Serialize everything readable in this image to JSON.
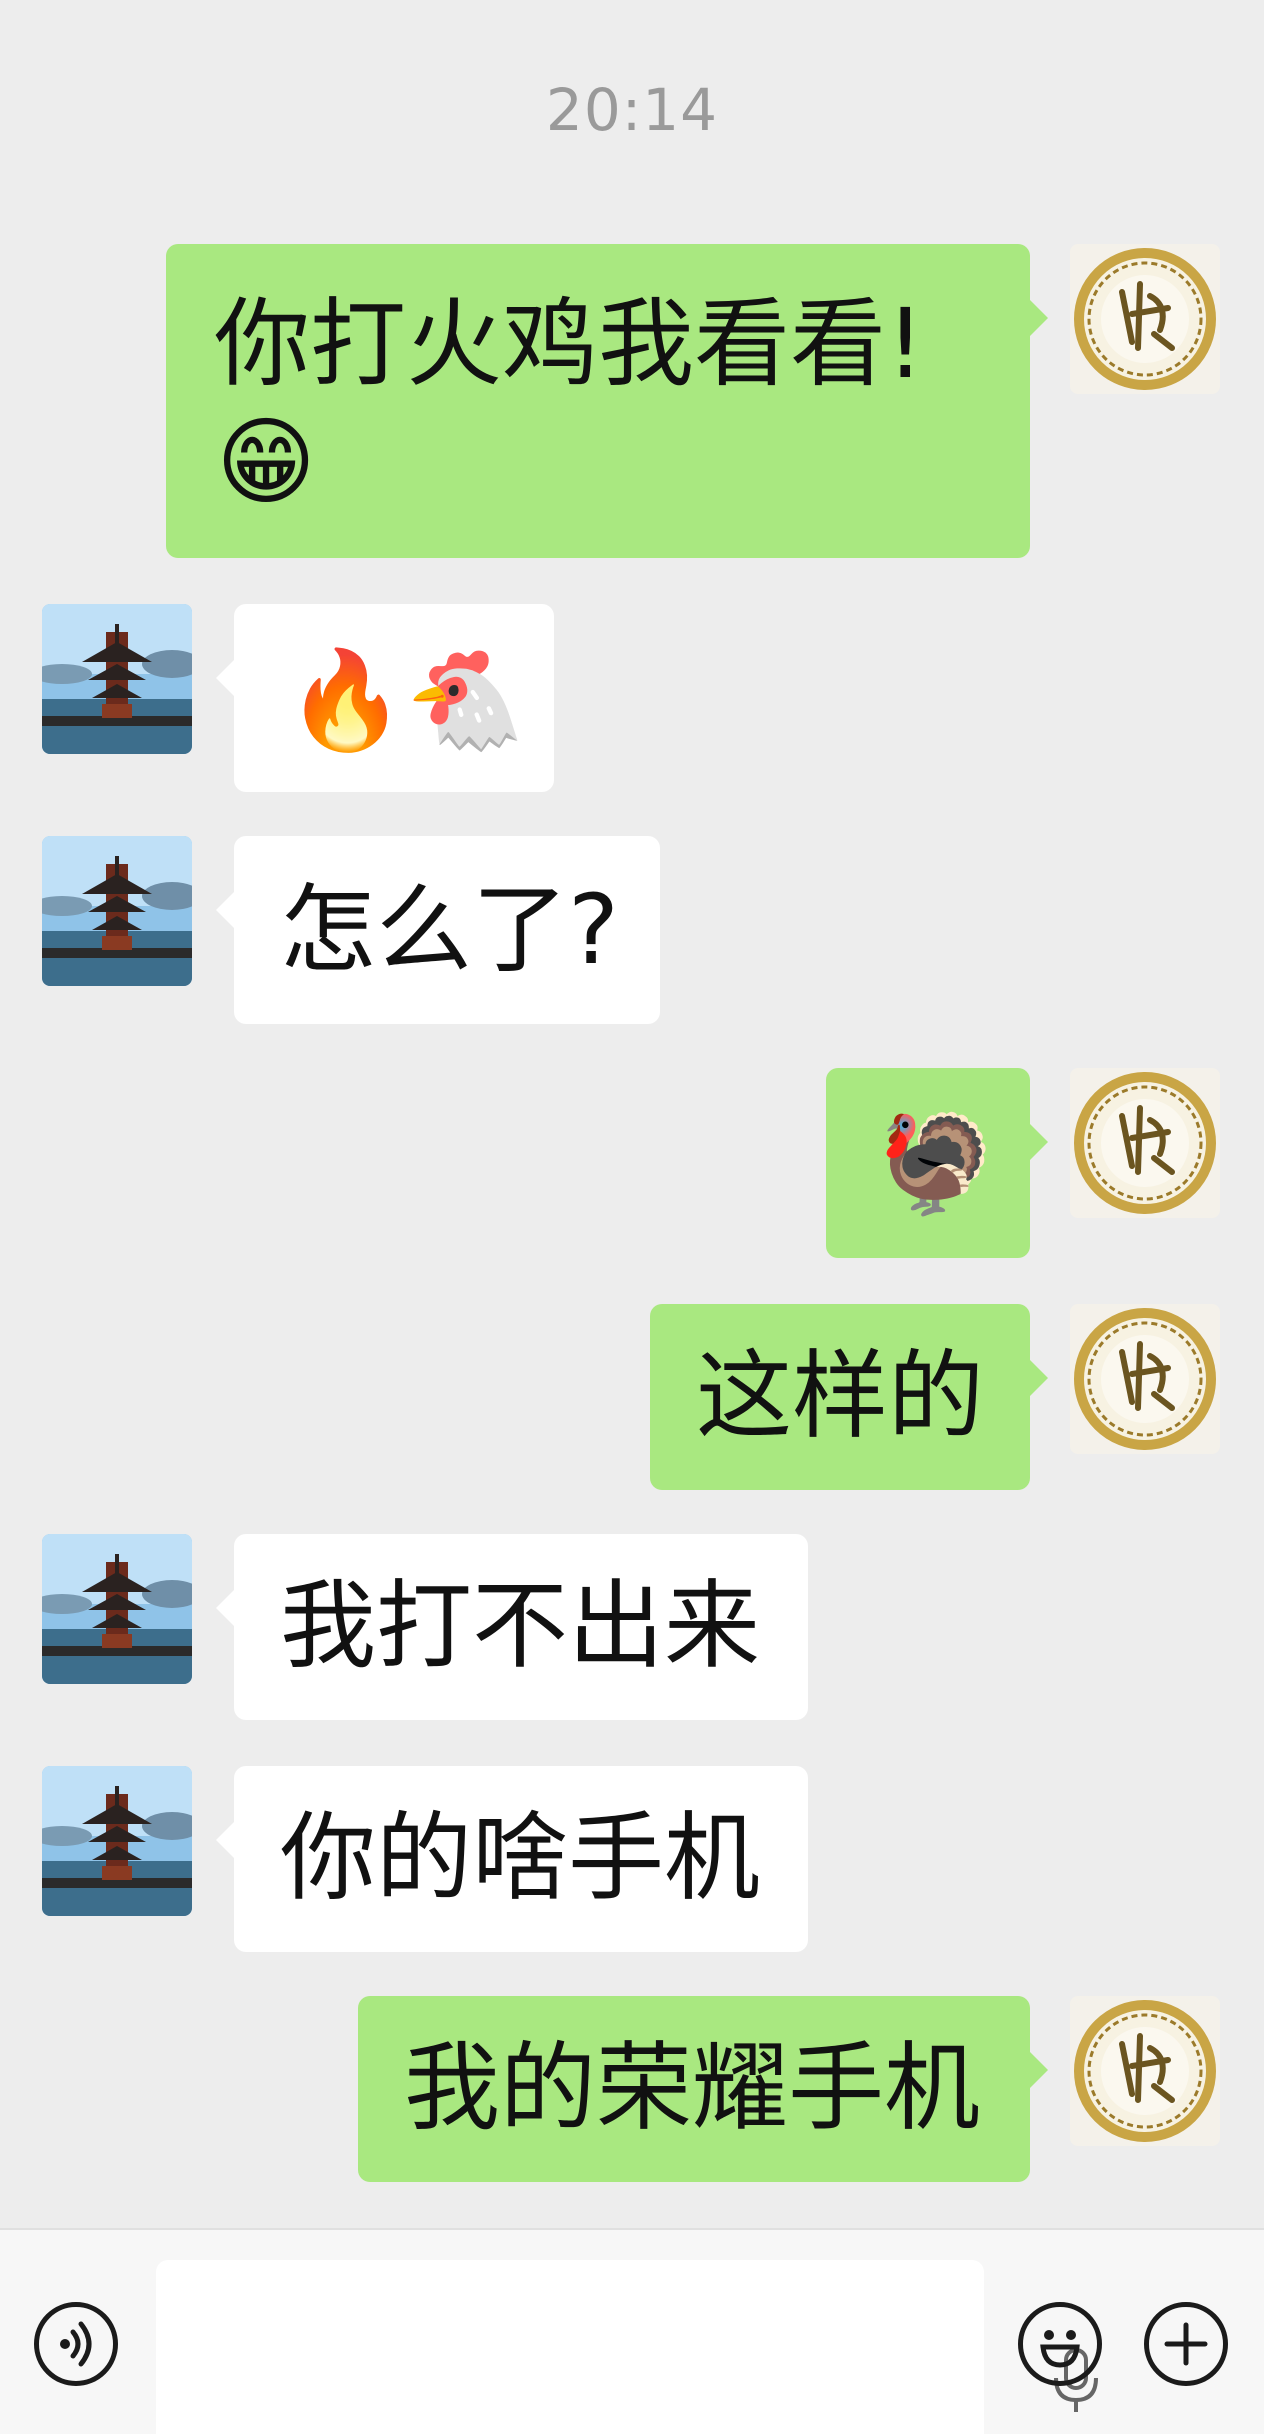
{
  "chat": {
    "timestamp": "20:14",
    "messages": [
      {
        "side": "out",
        "text": "你打火鸡我看看!",
        "emoji": "😁"
      },
      {
        "side": "in",
        "emoji": "🔥🐔"
      },
      {
        "side": "in",
        "text": "怎么了?"
      },
      {
        "side": "out",
        "emoji": "🦃"
      },
      {
        "side": "out",
        "text": "这样的"
      },
      {
        "side": "in",
        "text": "我打不出来"
      },
      {
        "side": "in",
        "text": "你的啥手机"
      },
      {
        "side": "out",
        "text": "我的荣耀手机"
      }
    ]
  },
  "input_bar": {
    "icons": [
      "voice-icon",
      "microphone-icon",
      "emoji-icon",
      "plus-icon"
    ],
    "colors": {
      "outgoing_bubble": "#a9e880",
      "incoming_bubble": "#ffffff",
      "background": "#ededed"
    }
  }
}
